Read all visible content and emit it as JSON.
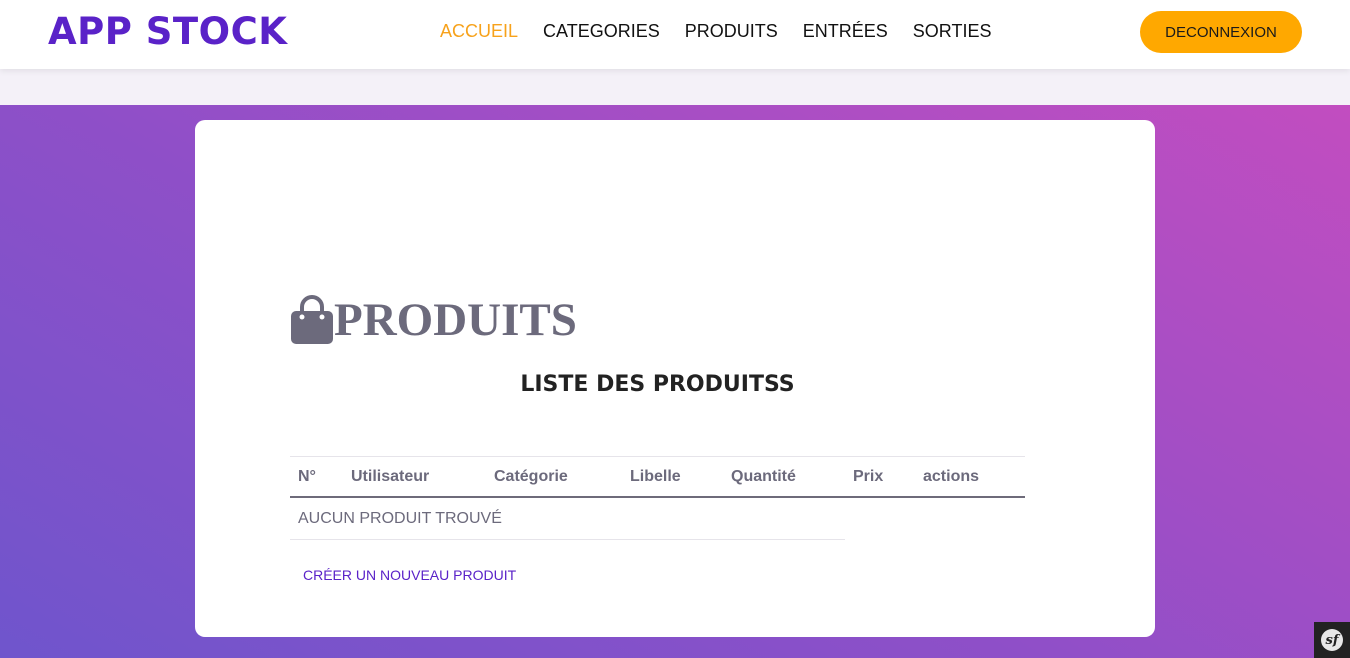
{
  "brand": "APP STOCK",
  "nav": {
    "items": [
      "ACCUEIL",
      "CATEGORIES",
      "PRODUITS",
      "ENTRÉES",
      "SORTIES"
    ],
    "active": "ACCUEIL"
  },
  "logout_label": "DECONNEXION",
  "page": {
    "title": "PRODUITS",
    "title_icon": "shopping-bag-icon",
    "subtitle": "LISTE DES PRODUITSS"
  },
  "table": {
    "headers": [
      "N°",
      "Utilisateur",
      "Catégorie",
      "Libelle",
      "Quantité",
      "Prix",
      "actions"
    ],
    "empty_message": "AUCUN PRODUIT TROUVÉ"
  },
  "create_link": "CRÉER UN NOUVEAU PRODUIT",
  "debug_toolbar": {
    "icon": "symfony-icon",
    "label": "sf"
  },
  "colors": {
    "brand": "#5a22c8",
    "active_nav": "#f7a21b",
    "logout_bg": "#ffa800",
    "gradient_start": "#6f55cc",
    "gradient_end": "#c24dc0",
    "text_muted": "#6c6a7c"
  }
}
